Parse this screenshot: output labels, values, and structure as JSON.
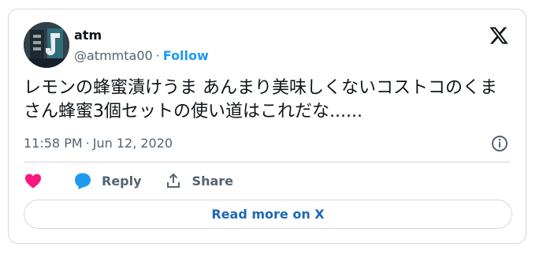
{
  "author": {
    "display_name": "atm",
    "handle": "@atmmta00",
    "separator": "·",
    "follow_label": "Follow",
    "avatar_icon": "avatar-image"
  },
  "header": {
    "logo_icon": "x-logo-icon"
  },
  "tweet": {
    "text": "レモンの蜂蜜漬けうま あんまり美味しくないコストコのくまさん蜂蜜3個セットの使い道はこれだな......"
  },
  "meta": {
    "time": "11:58 PM",
    "separator": "·",
    "date": "Jun 12, 2020",
    "info_icon": "info-icon"
  },
  "actions": {
    "like_icon": "heart-icon",
    "reply_label": "Reply",
    "reply_icon": "reply-bubble-icon",
    "share_label": "Share",
    "share_icon": "share-upload-icon"
  },
  "read_more_label": "Read more on X",
  "colors": {
    "accent": "#1d9bf0",
    "like": "#f91880",
    "secondary_text": "#536471",
    "border": "#cfd9de",
    "read_more_text": "#1d67b6"
  }
}
